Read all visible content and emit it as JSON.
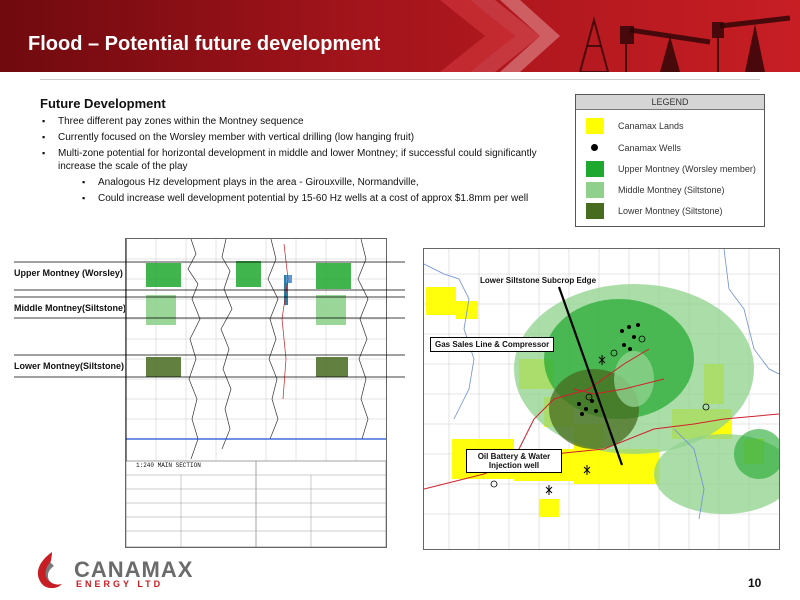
{
  "slide": {
    "title": "Flood – Potential future development",
    "page_number": "10"
  },
  "future": {
    "heading": "Future Development",
    "bullets": [
      "Three different pay zones within the Montney sequence",
      "Currently focused on the Worsley member with vertical drilling (low hanging fruit)",
      "Multi-zone potential for horizontal development in middle and lower Montney; if successful could significantly increase the scale of the play"
    ],
    "sub_bullets": [
      "Analogous Hz development plays in the area - Girouxville, Normandville,",
      "Could increase well development potential by 15-60 Hz wells at a cost of approx $1.8mm per well"
    ]
  },
  "legend": {
    "title": "LEGEND",
    "items": [
      {
        "label": "Canamax Lands",
        "color": "#ffff00",
        "icon": "swatch"
      },
      {
        "label": "Canamax Wells",
        "color": "#000000",
        "icon": "well-dot-icon"
      },
      {
        "label": "Upper Montney (Worsley member)",
        "color": "#1fa82e",
        "icon": "swatch"
      },
      {
        "label": "Middle Montney (Siltstone)",
        "color": "#8fd18c",
        "icon": "swatch"
      },
      {
        "label": "Lower Montney (Siltstone)",
        "color": "#476b1f",
        "icon": "swatch"
      }
    ]
  },
  "log": {
    "zones": [
      "Upper Montney (Worsley)",
      "Middle Montney(Siltstone)",
      "Lower Montney(Siltstone)"
    ],
    "section_label": "1:240 MAIN SECTION"
  },
  "map": {
    "labels": {
      "subcrop": "Lower Siltstone Subcrop Edge",
      "gas_sales": "Gas Sales Line & Compressor",
      "battery_line1": "Oil Battery & Water",
      "battery_line2": "Injection well"
    }
  },
  "logo": {
    "name": "CANAMAX",
    "tagline": "ENERGY LTD"
  },
  "colors": {
    "brand_red": "#c71e24",
    "lands_yellow": "#ffff00",
    "upper_green": "#1fa82e",
    "middle_green": "#8fd18c",
    "lower_green": "#476b1f"
  }
}
